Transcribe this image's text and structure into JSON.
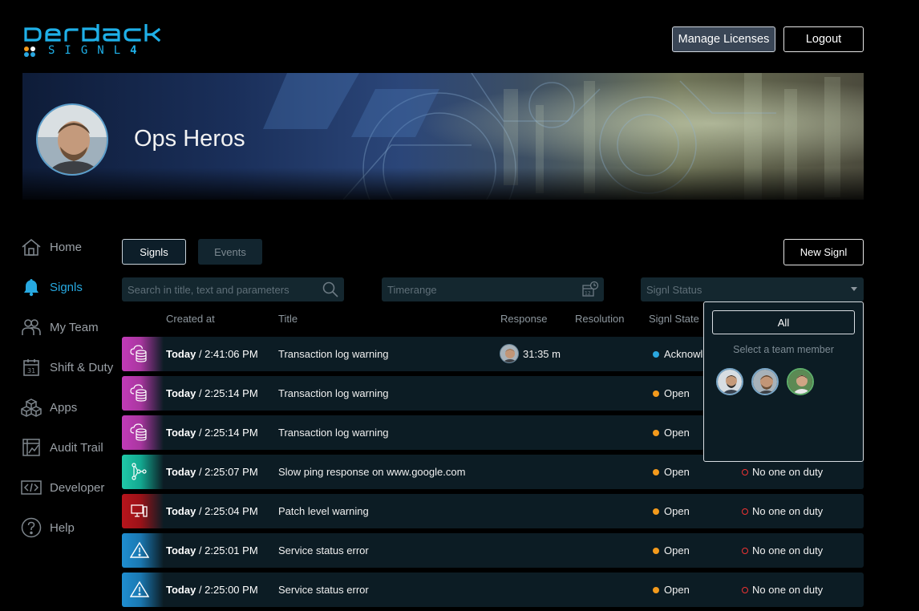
{
  "app": {
    "logo_main": "DERDACK",
    "logo_sub": "SIGNL",
    "logo_version": "4",
    "brand_color": "#1fb0e8"
  },
  "header": {
    "manage_licenses": "Manage Licenses",
    "logout": "Logout"
  },
  "banner": {
    "team_name": "Ops Heros"
  },
  "sidebar": {
    "items": [
      {
        "label": "Home",
        "icon": "home-icon"
      },
      {
        "label": "Signls",
        "icon": "bell-icon"
      },
      {
        "label": "My Team",
        "icon": "team-icon"
      },
      {
        "label": "Shift & Duty",
        "icon": "calendar-icon"
      },
      {
        "label": "Apps",
        "icon": "cubes-icon"
      },
      {
        "label": "Audit Trail",
        "icon": "audit-chart-icon"
      },
      {
        "label": "Developer",
        "icon": "code-icon"
      },
      {
        "label": "Help",
        "icon": "help-icon"
      }
    ],
    "active": "Signls"
  },
  "toolbar": {
    "tab_signls": "Signls",
    "tab_events": "Events",
    "new_signl": "New Signl",
    "search_placeholder": "Search in title, text and parameters",
    "timerange_placeholder": "Timerange",
    "status_placeholder": "Signl Status"
  },
  "table": {
    "columns": [
      "Created at",
      "Title",
      "Response",
      "Resolution",
      "Signl State"
    ],
    "rows": [
      {
        "category": "cloud-data",
        "day": "Today",
        "time": " / 2:41:06 PM",
        "title": "Transaction log warning",
        "response": "31:35 m",
        "state": "Acknowledged",
        "state_color": "#2aa7e0",
        "duty": ""
      },
      {
        "category": "cloud-data",
        "day": "Today",
        "time": " / 2:25:14 PM",
        "title": "Transaction log warning",
        "response": "",
        "state": "Open",
        "state_color": "#f39a1c",
        "duty": ""
      },
      {
        "category": "cloud-data",
        "day": "Today",
        "time": " / 2:25:14 PM",
        "title": "Transaction log warning",
        "response": "",
        "state": "Open",
        "state_color": "#f39a1c",
        "duty": ""
      },
      {
        "category": "network",
        "day": "Today",
        "time": " / 2:25:07 PM",
        "title": "Slow ping response on www.google.com",
        "response": "",
        "state": "Open",
        "state_color": "#f39a1c",
        "duty": "No one on duty"
      },
      {
        "category": "computer",
        "day": "Today",
        "time": " / 2:25:04 PM",
        "title": "Patch level warning",
        "response": "",
        "state": "Open",
        "state_color": "#f39a1c",
        "duty": "No one on duty"
      },
      {
        "category": "warning",
        "day": "Today",
        "time": " / 2:25:01 PM",
        "title": "Service status error",
        "response": "",
        "state": "Open",
        "state_color": "#f39a1c",
        "duty": "No one on duty"
      },
      {
        "category": "warning",
        "day": "Today",
        "time": " / 2:25:00 PM",
        "title": "Service status error",
        "response": "",
        "state": "Open",
        "state_color": "#f39a1c",
        "duty": "No one on duty"
      }
    ]
  },
  "dropdown": {
    "all_label": "All",
    "hint": "Select a team member",
    "members": [
      "member-1",
      "member-2",
      "member-3"
    ]
  }
}
